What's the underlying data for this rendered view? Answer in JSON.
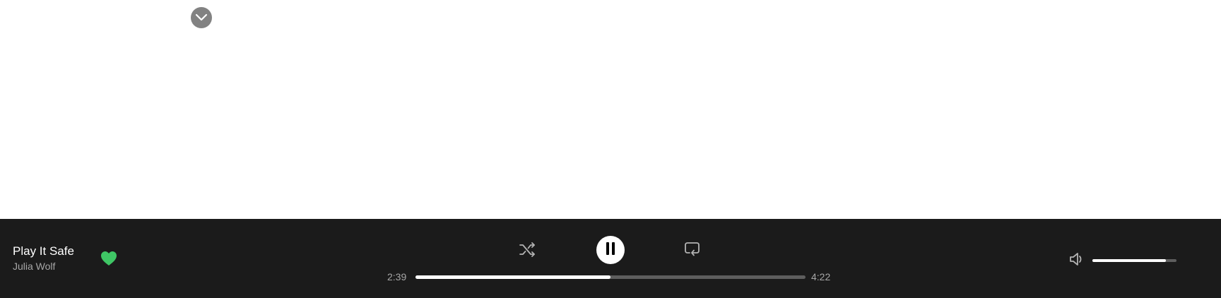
{
  "now_playing": {
    "title": "Play It Safe",
    "artist": "Julia Wolf",
    "liked": true
  },
  "playback": {
    "elapsed": "2:39",
    "total": "4:22",
    "progress_fraction": 0.5,
    "state": "playing",
    "shuffle_icon": "shuffle-icon",
    "pause_icon": "pause-icon",
    "repeat_icon": "repeat-icon"
  },
  "volume": {
    "level_fraction": 0.87,
    "icon": "volume-icon"
  },
  "collapse": {
    "icon": "chevron-down-icon"
  },
  "colors": {
    "player_background": "#1b1b1b",
    "like_accent": "#3fc665",
    "track_fill": "#ffffff",
    "track_empty": "#5e5e5e",
    "secondary_text": "#a7a7a7",
    "collapse_button": "#828282"
  }
}
